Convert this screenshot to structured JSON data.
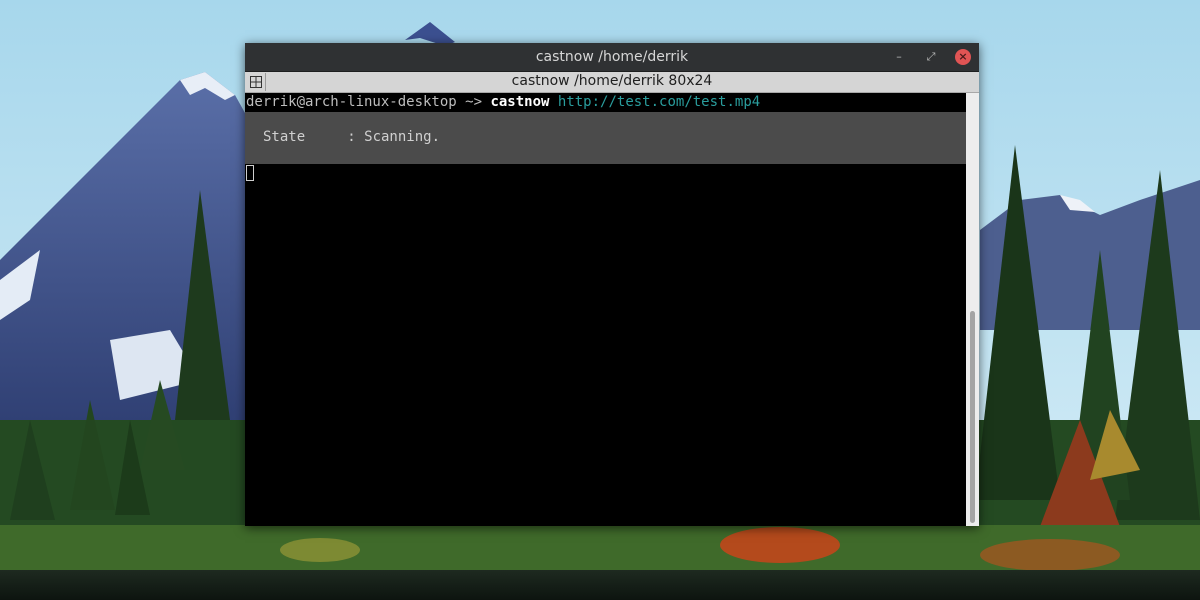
{
  "window": {
    "title": "castnow  /home/derrik",
    "minimize_glyph": "–",
    "maximize_glyph": "⤢",
    "close_glyph": "×"
  },
  "tab": {
    "title": "castnow  /home/derrik 80x24",
    "menu_icon": "tab-menu-icon"
  },
  "terminal": {
    "prompt": "derrik@arch-linux-desktop ~> ",
    "command": "castnow",
    "argument": "http://test.com/test.mp4",
    "status_line": "State     : Scanning."
  },
  "colors": {
    "titlebar": "#2f3133",
    "tabbar": "#d5d5d5",
    "terminal_bg": "#000000",
    "status_panel": "#4b4b4b",
    "url": "#2a9d9d",
    "close_button": "#e05454"
  }
}
